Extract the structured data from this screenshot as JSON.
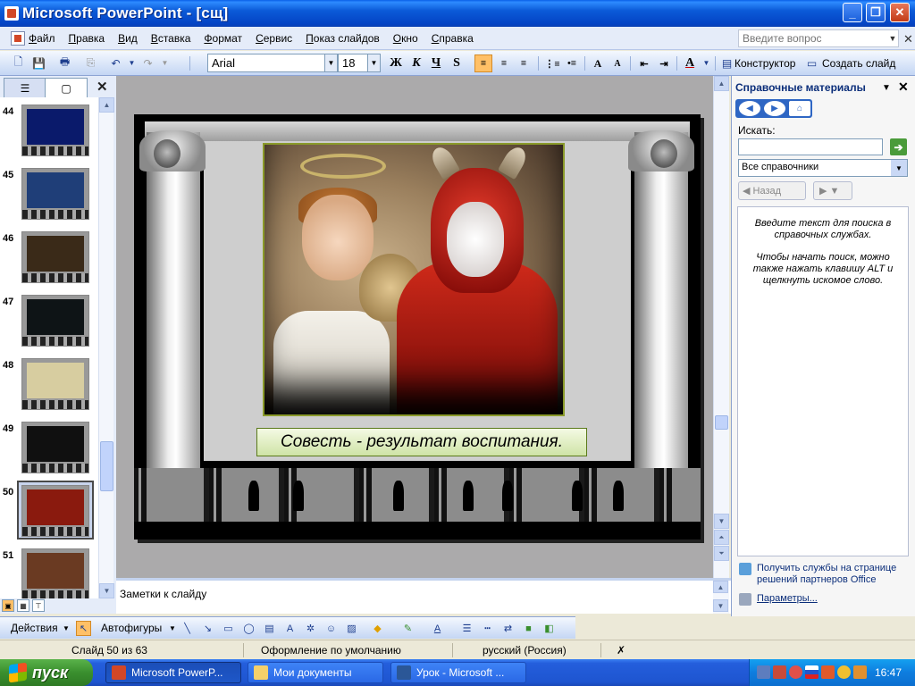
{
  "window": {
    "title": "Microsoft PowerPoint - [сщ]",
    "minimize_label": "_",
    "maximize_label": "❐",
    "close_label": "✕"
  },
  "menu": {
    "items": [
      "Файл",
      "Правка",
      "Вид",
      "Вставка",
      "Формат",
      "Сервис",
      "Показ слайдов",
      "Окно",
      "Справка"
    ],
    "help_placeholder": "Введите вопрос",
    "close_label": "✕"
  },
  "toolbar": {
    "font_name": "Arial",
    "font_size": "18",
    "bold_label": "Ж",
    "italic_label": "К",
    "underline_label": "Ч",
    "shadow_label": "S",
    "designer_label": "Конструктор",
    "new_slide_label": "Создать слайд"
  },
  "slides_panel": {
    "tab_outline_icon": "outline-icon",
    "tab_slides_icon": "slides-icon",
    "close_label": "✕",
    "thumbs": [
      {
        "num": "44",
        "color": "#0A1A6B"
      },
      {
        "num": "45",
        "color": "#1F3E78"
      },
      {
        "num": "46",
        "color": "#3A2A18"
      },
      {
        "num": "47",
        "color": "#0E1416"
      },
      {
        "num": "48",
        "color": "#D7CDA0"
      },
      {
        "num": "49",
        "color": "#101010"
      },
      {
        "num": "50",
        "color": "#8A1A0E",
        "selected": true
      },
      {
        "num": "51",
        "color": "#6A3A22"
      }
    ]
  },
  "slide": {
    "caption": "Совесть - результат воспитания."
  },
  "notes": {
    "placeholder": "Заметки к слайду"
  },
  "task_pane": {
    "title": "Справочные материалы",
    "search_label": "Искать:",
    "search_value": "",
    "references_select": "Все справочники",
    "back_label": "Назад",
    "info_line1": "Введите текст для поиска в справочных службах.",
    "info_line2": "Чтобы начать поиск, можно также нажать клавишу ALT и щелкнуть искомое слово.",
    "link_services": "Получить службы на странице решений партнеров Office",
    "link_params": "Параметры..."
  },
  "drawing_toolbar": {
    "actions_label": "Действия",
    "autoshapes_label": "Автофигуры"
  },
  "status": {
    "slide_info": "Слайд 50 из 63",
    "design": "Оформление по умолчанию",
    "language": "русский (Россия)"
  },
  "taskbar": {
    "start_label": "пуск",
    "tasks": [
      {
        "label": "Microsoft PowerP...",
        "active": true
      },
      {
        "label": "Мои документы",
        "active": false
      },
      {
        "label": "Урок - Microsoft ...",
        "active": false
      }
    ],
    "clock": "16:47"
  },
  "colors": {
    "title_bar": "#0B5AD8",
    "start_button": "#3A8F2E",
    "selected_button": "#FFC067",
    "caption_bg": "#CFE3A6"
  }
}
